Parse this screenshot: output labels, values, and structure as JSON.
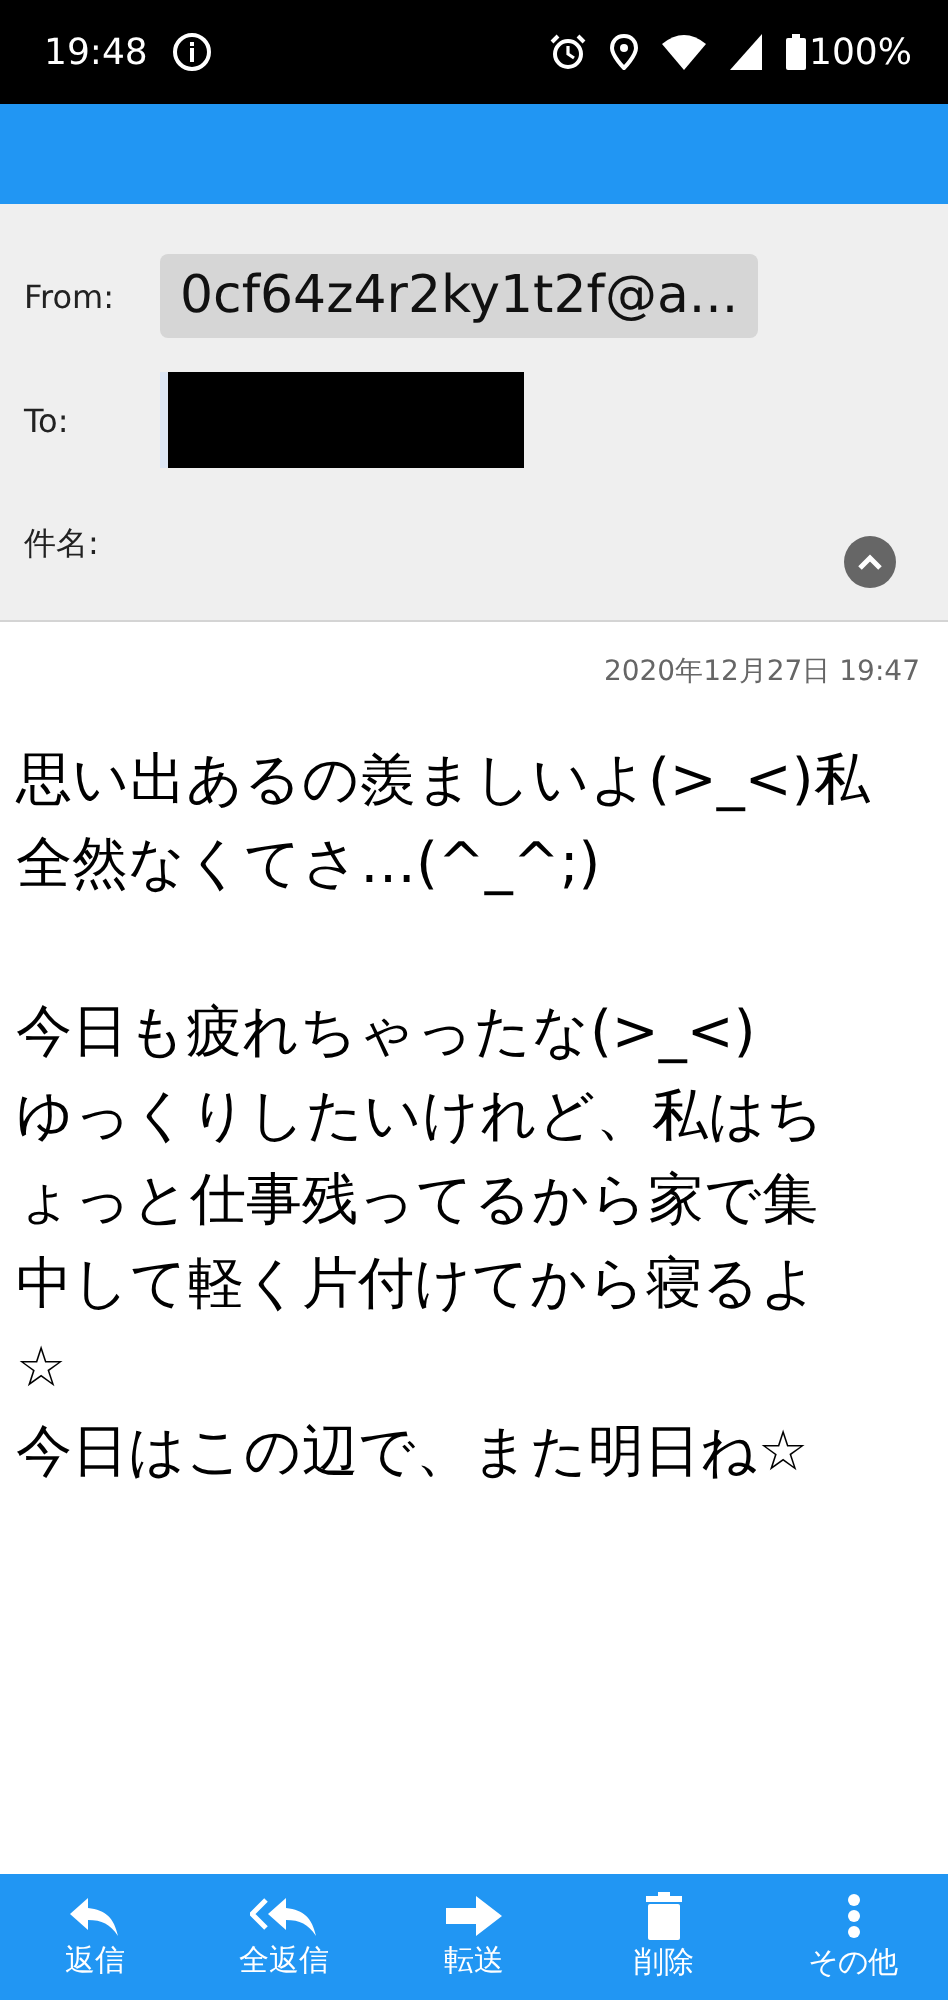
{
  "status_bar": {
    "time": "19:48",
    "battery": "100%"
  },
  "header": {
    "from_label": "From:",
    "from_value": "0cf64z4r2ky1t2f@a...",
    "to_label": "To:",
    "subject_label": "件名:",
    "expanded": true
  },
  "date": "2020年12月27日 19:47",
  "body": [
    [
      "思い出あるの羨ましいよ(>_<)私",
      "全然なくてさ…(^_^;)"
    ],
    [
      "今日も疲れちゃったな(>_<)",
      "ゆっくりしたいけれど、私はち",
      "ょっと仕事残ってるから家で集",
      "中して軽く片付けてから寝るよ",
      "☆",
      "今日はこの辺で、また明日ね☆"
    ]
  ],
  "toolbar": [
    {
      "kind": "reply",
      "label": "返信"
    },
    {
      "kind": "reply-all",
      "label": "全返信"
    },
    {
      "kind": "forward",
      "label": "転送"
    },
    {
      "kind": "delete",
      "label": "削除"
    },
    {
      "kind": "more",
      "label": "その他"
    }
  ]
}
